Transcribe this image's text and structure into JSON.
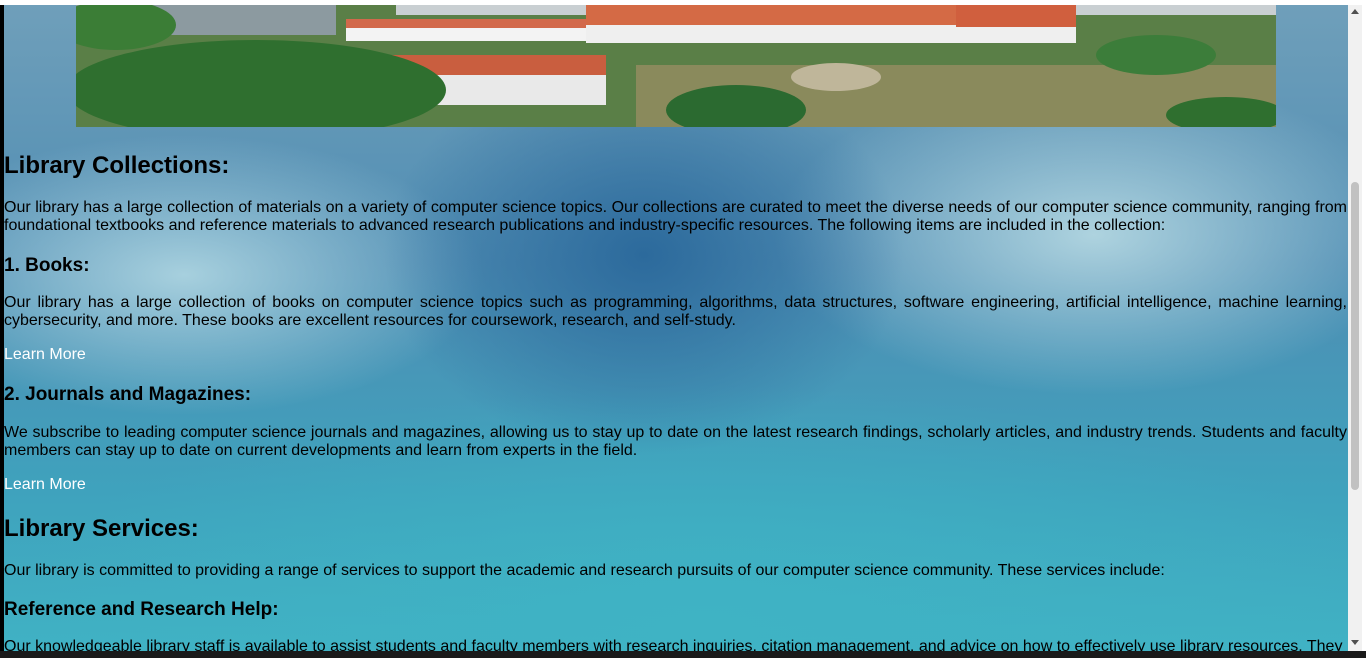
{
  "collections": {
    "heading": "Library Collections:",
    "intro": "Our library has a large collection of materials on a variety of computer science topics. Our collections are curated to meet the diverse needs of our computer science community, ranging from foundational textbooks and reference materials to advanced research publications and industry-specific resources. The following items are included in the collection:",
    "items": [
      {
        "title": "1. Books:",
        "text": "Our library has a large collection of books on computer science topics such as programming, algorithms, data structures, software engineering, artificial intelligence, machine learning, cybersecurity, and more. These books are excellent resources for coursework, research, and self-study.",
        "link": "Learn More"
      },
      {
        "title": "2. Journals and Magazines:",
        "text": "We subscribe to leading computer science journals and magazines, allowing us to stay up to date on the latest research findings, scholarly articles, and industry trends. Students and faculty members can stay up to date on current developments and learn from experts in the field.",
        "link": "Learn More"
      }
    ]
  },
  "services": {
    "heading": "Library Services:",
    "intro": "Our library is committed to providing a range of services to support the academic and research pursuits of our computer science community. These services include:",
    "items": [
      {
        "title": "Reference and Research Help:",
        "text": "Our knowledgeable library staff is available to assist students and faculty members with research inquiries, citation management, and advice on how to effectively use library resources. They"
      }
    ]
  },
  "colors": {
    "link": "#ffffff",
    "background_top": "#6f9fba",
    "background_bottom": "#40b2c4"
  }
}
